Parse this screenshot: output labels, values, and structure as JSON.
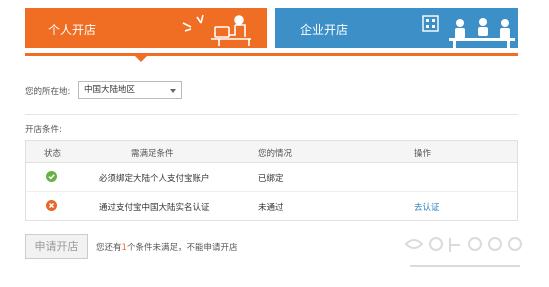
{
  "tabs": {
    "personal": {
      "label": "个人开店"
    },
    "company": {
      "label": "企业开店"
    }
  },
  "location": {
    "label": "您的所在地:",
    "selected": "中国大陆地区"
  },
  "conditions": {
    "label": "开店条件:",
    "headers": [
      "状态",
      "需满足条件",
      "您的情况",
      "操作"
    ],
    "rows": [
      {
        "status": "ok",
        "condition": "必须绑定大陆个人支付宝账户",
        "situation": "已绑定",
        "action": ""
      },
      {
        "status": "fail",
        "condition": "通过支付宝中国大陆实名认证",
        "situation": "未通过",
        "action": "去认证"
      }
    ]
  },
  "apply": {
    "button": "申请开店",
    "note_prefix": "您还有",
    "count": "1",
    "note_suffix": "个条件未满足，不能申请开店"
  },
  "colors": {
    "orange": "#f06d24",
    "blue": "#3d8fc7",
    "ok": "#66b342",
    "fail": "#e8662a"
  }
}
